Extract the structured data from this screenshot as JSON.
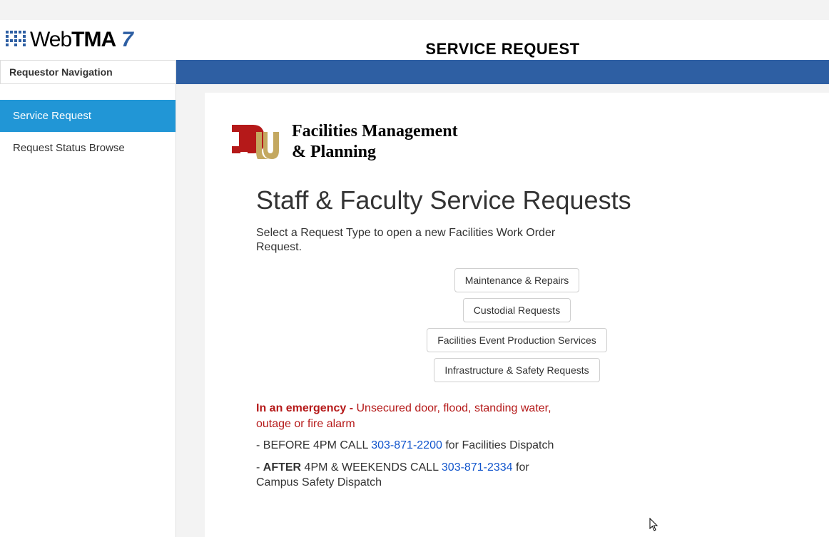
{
  "app": {
    "logo_text_regular": "Web",
    "logo_text_bold": "TMA",
    "logo_seven": "7",
    "page_title": "SERVICE REQUEST"
  },
  "sidebar": {
    "header": "Requestor Navigation",
    "items": [
      {
        "label": "Service Request",
        "active": true
      },
      {
        "label": "Request Status Browse",
        "active": false
      }
    ]
  },
  "main": {
    "dept_name_line1": "Facilities Management",
    "dept_name_line2": "& Planning",
    "heading": "Staff & Faculty Service Requests",
    "subtitle": "Select a Request Type to open a new Facilities Work Order Request.",
    "buttons": [
      "Maintenance & Repairs",
      "Custodial Requests",
      "Facilities Event Production Services",
      "Infrastructure & Safety Requests"
    ],
    "emergency": {
      "label": "In an emergency - ",
      "desc": "Unsecured door, flood, standing water, outage or fire alarm"
    },
    "calls": [
      {
        "prefix": " - BEFORE 4PM CALL ",
        "bold_word": "",
        "phone": "303-871-2200",
        "suffix": " for Facilities Dispatch"
      },
      {
        "prefix": " - ",
        "bold_word": "AFTER",
        "mid": " 4PM & WEEKENDS CALL ",
        "phone": "303-871-2334",
        "suffix": " for Campus Safety Dispatch"
      }
    ]
  }
}
